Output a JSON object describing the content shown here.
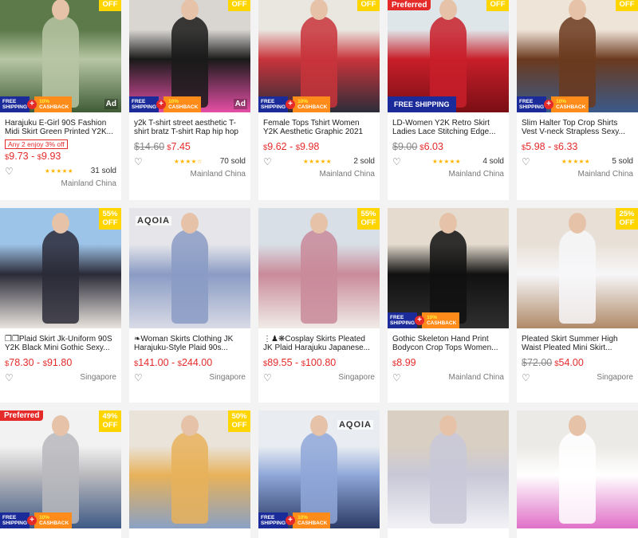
{
  "products": [
    {
      "title": "Harajuku E-Girl 90S Fashion Midi Skirt Green Printed Y2K...",
      "promo": "Any 2 enjoy 3% off",
      "price_from": "9.73",
      "price_to": "9.93",
      "old_price": "",
      "stars": "★★★★★",
      "sold": "31 sold",
      "location": "Mainland China",
      "discount": "OFF",
      "badge_ad": "Ad",
      "badge_pref": "",
      "shipping": "free-cashback",
      "colors": [
        "#5c7a4a",
        "#b7c6a4",
        "#3f5c36"
      ]
    },
    {
      "title": "y2k T-shirt street aesthetic T-shirt bratz T-shirt Rap hip hop ...",
      "promo": "",
      "price_from": "7.45",
      "price_to": "",
      "old_price": "$14.60",
      "stars": "★★★★☆",
      "sold": "70 sold",
      "location": "Mainland China",
      "discount": "OFF",
      "badge_ad": "Ad",
      "badge_pref": "",
      "shipping": "free-cashback",
      "colors": [
        "#d9d6d2",
        "#1a1a1a",
        "#e64fa6"
      ]
    },
    {
      "title": "Female Tops Tshirt Women Y2K Aesthetic Graphic 2021 Cko...",
      "promo": "",
      "price_from": "9.62",
      "price_to": "9.98",
      "old_price": "",
      "stars": "★★★★★",
      "sold": "2 sold",
      "location": "Mainland China",
      "discount": "OFF",
      "badge_ad": "",
      "badge_pref": "",
      "shipping": "free-cashback",
      "colors": [
        "#eae6e0",
        "#c8343b",
        "#2d2d3a"
      ]
    },
    {
      "title": "LD-Women Y2K Retro Skirt Ladies Lace Stitching Edge...",
      "promo": "",
      "price_from": "6.03",
      "price_to": "",
      "old_price": "$9.00",
      "stars": "★★★★★",
      "sold": "4 sold",
      "location": "Mainland China",
      "discount": "OFF",
      "badge_ad": "",
      "badge_pref": "Preferred",
      "shipping": "free-wide",
      "colors": [
        "#dfe6ea",
        "#c81f2a",
        "#7a0e14"
      ]
    },
    {
      "title": "Slim Halter Top Crop Shirts Vest V-neck Strapless Sexy...",
      "promo": "",
      "price_from": "5.98",
      "price_to": "6.33",
      "old_price": "",
      "stars": "★★★★★",
      "sold": "5 sold",
      "location": "Mainland China",
      "discount": "OFF",
      "badge_ad": "",
      "badge_pref": "",
      "shipping": "free-cashback",
      "colors": [
        "#efe4d8",
        "#6b3a1e",
        "#3a5a8a"
      ]
    },
    {
      "title": "❒❒Plaid Skirt Jk-Uniform 90S Y2K Black Mini Gothic Sexy...",
      "promo": "",
      "price_from": "78.30",
      "price_to": "91.80",
      "old_price": "",
      "stars": "",
      "sold": "",
      "location": "Singapore",
      "discount": "55%\nOFF",
      "badge_ad": "",
      "badge_pref": "",
      "shipping": "",
      "colors": [
        "#9cc3e8",
        "#2b2b38",
        "#e9e4de"
      ]
    },
    {
      "title": "❧Woman Skirts Clothing JK Harajuku-Style Plaid 90s...",
      "promo": "",
      "price_from": "141.00",
      "price_to": "244.00",
      "old_price": "",
      "stars": "",
      "sold": "",
      "location": "Singapore",
      "discount": "",
      "badge_ad": "",
      "badge_pref": "",
      "shipping": "",
      "colors": [
        "#e6e6ea",
        "#8a9bc4",
        "#d9dbe6"
      ],
      "brand": "AQOIA"
    },
    {
      "title": "⋮♟❋Cosplay Skirts Pleated JK Plaid Harajuku Japanese...",
      "promo": "",
      "price_from": "89.55",
      "price_to": "100.80",
      "old_price": "",
      "stars": "",
      "sold": "",
      "location": "Singapore",
      "discount": "55%\nOFF",
      "badge_ad": "",
      "badge_pref": "",
      "shipping": "",
      "colors": [
        "#d8dfe6",
        "#c98a9a",
        "#f0ece8"
      ]
    },
    {
      "title": "Gothic Skeleton Hand Print Bodycon Crop Tops Women...",
      "promo": "",
      "price_from": "8.99",
      "price_to": "",
      "old_price": "",
      "stars": "",
      "sold": "",
      "location": "Mainland China",
      "discount": "",
      "badge_ad": "",
      "badge_pref": "",
      "shipping": "free-cashback",
      "colors": [
        "#e5dccf",
        "#111111",
        "#2f2f2f"
      ]
    },
    {
      "title": "Pleated Skirt Summer High Waist Pleated Mini Skirt...",
      "promo": "",
      "price_from": "54.00",
      "price_to": "",
      "old_price": "$72.00",
      "stars": "",
      "sold": "",
      "location": "Singapore",
      "discount": "25%\nOFF",
      "badge_ad": "",
      "badge_pref": "",
      "shipping": "",
      "colors": [
        "#e8e0d6",
        "#f7f7f9",
        "#b08a68"
      ]
    },
    {
      "title": "",
      "promo": "",
      "price_from": "",
      "price_to": "",
      "old_price": "",
      "stars": "",
      "sold": "",
      "location": "",
      "discount": "49%\nOFF",
      "badge_ad": "",
      "badge_pref": "Preferred",
      "shipping": "free-cashback",
      "colors": [
        "#f2f2f2",
        "#b9b9bd",
        "#3e5a86"
      ]
    },
    {
      "title": "",
      "promo": "",
      "price_from": "",
      "price_to": "",
      "old_price": "",
      "stars": "",
      "sold": "",
      "location": "",
      "discount": "50%\nOFF",
      "badge_ad": "",
      "badge_pref": "",
      "shipping": "",
      "colors": [
        "#e9e3da",
        "#e8b25a",
        "#8aa1c4"
      ]
    },
    {
      "title": "",
      "promo": "",
      "price_from": "",
      "price_to": "",
      "old_price": "",
      "stars": "",
      "sold": "",
      "location": "",
      "discount": "",
      "badge_ad": "",
      "badge_pref": "",
      "shipping": "free-cashback",
      "colors": [
        "#e9edf2",
        "#8fa7d8",
        "#2b3a66"
      ],
      "brand": "AQOIA"
    },
    {
      "title": "",
      "promo": "",
      "price_from": "",
      "price_to": "",
      "old_price": "",
      "stars": "",
      "sold": "",
      "location": "",
      "discount": "",
      "badge_ad": "",
      "badge_pref": "",
      "shipping": "",
      "colors": [
        "#d9cfc2",
        "#c8c8d8",
        "#f2f2f6"
      ]
    },
    {
      "title": "",
      "promo": "",
      "price_from": "",
      "price_to": "",
      "old_price": "",
      "stars": "",
      "sold": "",
      "location": "",
      "discount": "",
      "badge_ad": "",
      "badge_pref": "",
      "shipping": "",
      "colors": [
        "#eceae6",
        "#ffffff",
        "#e070c8"
      ]
    }
  ],
  "labels": {
    "currency": "$",
    "free_shipping_line1": "FREE",
    "free_shipping_line2": "SHIPPING",
    "free_shipping_wide": "FREE SHIPPING",
    "cashback_pct": "10%",
    "cashback_word": "CASHBACK",
    "heart_glyph": "♡"
  }
}
